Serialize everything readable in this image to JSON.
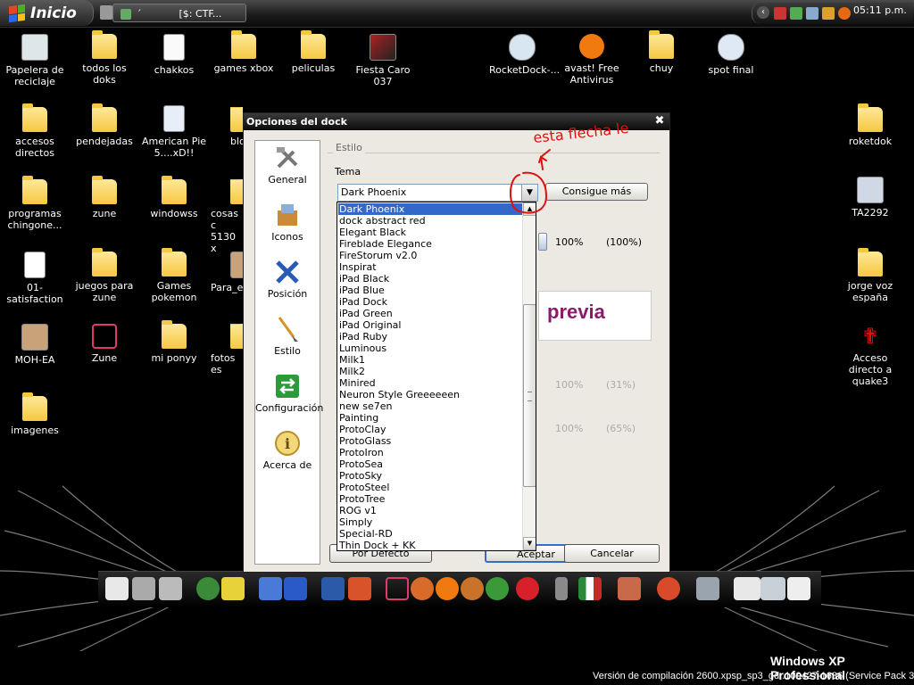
{
  "taskbar": {
    "start_label": "Inicio",
    "task_label": "[$: CTF...",
    "task_prefix": "´",
    "clock": "05:11 p.m."
  },
  "desktop_icons": [
    {
      "label": "Papelera de reciclaje",
      "icon": "recycle-bin-icon"
    },
    {
      "label": "todos los doks",
      "icon": "folder-icon"
    },
    {
      "label": "chakkos",
      "icon": "document-icon"
    },
    {
      "label": "games xbox",
      "icon": "folder-icon"
    },
    {
      "label": "peliculas",
      "icon": "folder-icon"
    },
    {
      "label": "Fiesta Caro 037",
      "icon": "image-icon"
    },
    {
      "label": "RocketDock-...",
      "icon": "installer-icon"
    },
    {
      "label": "avast! Free Antivirus",
      "icon": "avast-icon"
    },
    {
      "label": "chuy",
      "icon": "folder-icon"
    },
    {
      "label": "spot final",
      "icon": "media-icon"
    },
    {
      "label": "accesos directos",
      "icon": "folder-icon"
    },
    {
      "label": "pendejadas",
      "icon": "folder-icon"
    },
    {
      "label": "American Pie 5....xD!!",
      "icon": "video-file-icon"
    },
    {
      "label": "blo",
      "icon": "folder-icon"
    },
    {
      "label": "roketdok",
      "icon": "folder-icon"
    },
    {
      "label": "programas chingone...",
      "icon": "folder-icon"
    },
    {
      "label": "zune",
      "icon": "folder-icon"
    },
    {
      "label": "windowss",
      "icon": "folder-icon"
    },
    {
      "label": "cosas c 5130 x",
      "icon": "folder-icon"
    },
    {
      "label": "TA2292",
      "icon": "computer-icon"
    },
    {
      "label": "01-satisfaction",
      "icon": "mp3-file-icon"
    },
    {
      "label": "juegos para zune",
      "icon": "folder-icon"
    },
    {
      "label": "Games pokemon",
      "icon": "folder-icon"
    },
    {
      "label": "Para_e",
      "icon": "box-icon"
    },
    {
      "label": "jorge voz españa",
      "icon": "folder-icon"
    },
    {
      "label": "MOH-EA",
      "icon": "box-icon"
    },
    {
      "label": "Zune",
      "icon": "zune-icon"
    },
    {
      "label": "mi ponyy",
      "icon": "folder-icon"
    },
    {
      "label": "fotos es",
      "icon": "folder-icon"
    },
    {
      "label": "Acceso directo a quake3",
      "icon": "quake-icon"
    },
    {
      "label": "imagenes",
      "icon": "folder-icon"
    }
  ],
  "dialog": {
    "title": "Opciones del dock",
    "categories": [
      {
        "label": "General",
        "icon": "tools-icon"
      },
      {
        "label": "Iconos",
        "icon": "icons-box-icon"
      },
      {
        "label": "Posición",
        "icon": "move-arrows-icon"
      },
      {
        "label": "Estilo",
        "icon": "paintbrush-icon"
      },
      {
        "label": "Configuración",
        "icon": "settings-arrows-icon"
      },
      {
        "label": "Acerca de",
        "icon": "info-icon"
      }
    ],
    "group_label": "Estilo",
    "theme_label": "Tema",
    "theme_value": "Dark Phoenix",
    "more_button": "Consigue más",
    "slider1_value": "100%",
    "slider1_pct": "(100%)",
    "preview_text": "previa",
    "slider2_value": "100%",
    "slider2_pct": "(31%)",
    "slider3_value": "100%",
    "slider3_pct": "(65%)",
    "default_button": "Por Defecto",
    "ok_button": "Aceptar",
    "cancel_button": "Cancelar"
  },
  "theme_options": [
    "Dark Phoenix",
    "dock abstract red",
    "Elegant Black",
    "Fireblade Elegance",
    "FireStorum v2.0",
    "Inspirat",
    "iPad Black",
    "iPad Blue",
    "iPad Dock",
    "iPad Green",
    "iPad Original",
    "iPad Ruby",
    "Luminous",
    "Milk1",
    "Milk2",
    "Minired",
    "Neuron Style Greeeeeen",
    "new se7en",
    "Painting",
    "ProtoClay",
    "ProtoGlass",
    "ProtoIron",
    "ProtoSea",
    "ProtoSky",
    "ProtoSteel",
    "ProtoTree",
    "ROG v1",
    "Simply",
    "Special-RD",
    "Thin Dock + KK"
  ],
  "os": {
    "edition": "Windows XP Professional",
    "build": "Versión de compilación 2600.xpsp_sp3_gdr.100427-1636 (Service Pack 3)"
  },
  "annotation": {
    "text": "esta flecha le",
    "color": "#e01010"
  }
}
